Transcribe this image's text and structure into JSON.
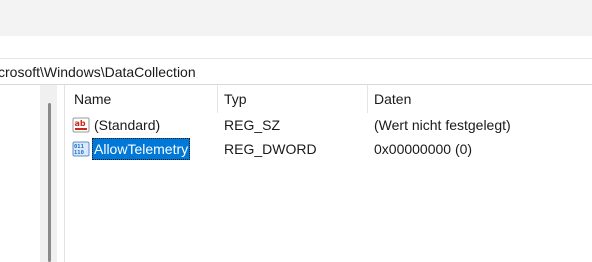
{
  "address": {
    "path": "crosoft\\Windows\\DataCollection"
  },
  "columns": {
    "name": "Name",
    "type": "Typ",
    "data": "Daten"
  },
  "rows": [
    {
      "icon": "string-value-icon",
      "name": "(Standard)",
      "type": "REG_SZ",
      "data": "(Wert nicht festgelegt)",
      "selected": false
    },
    {
      "icon": "dword-value-icon",
      "name": "AllowTelemetry",
      "type": "REG_DWORD",
      "data": "0x00000000 (0)",
      "selected": true
    }
  ],
  "colors": {
    "selection": "#0078d7",
    "string_icon_red": "#c42b1c",
    "dword_icon_blue": "#1c6fc4"
  }
}
